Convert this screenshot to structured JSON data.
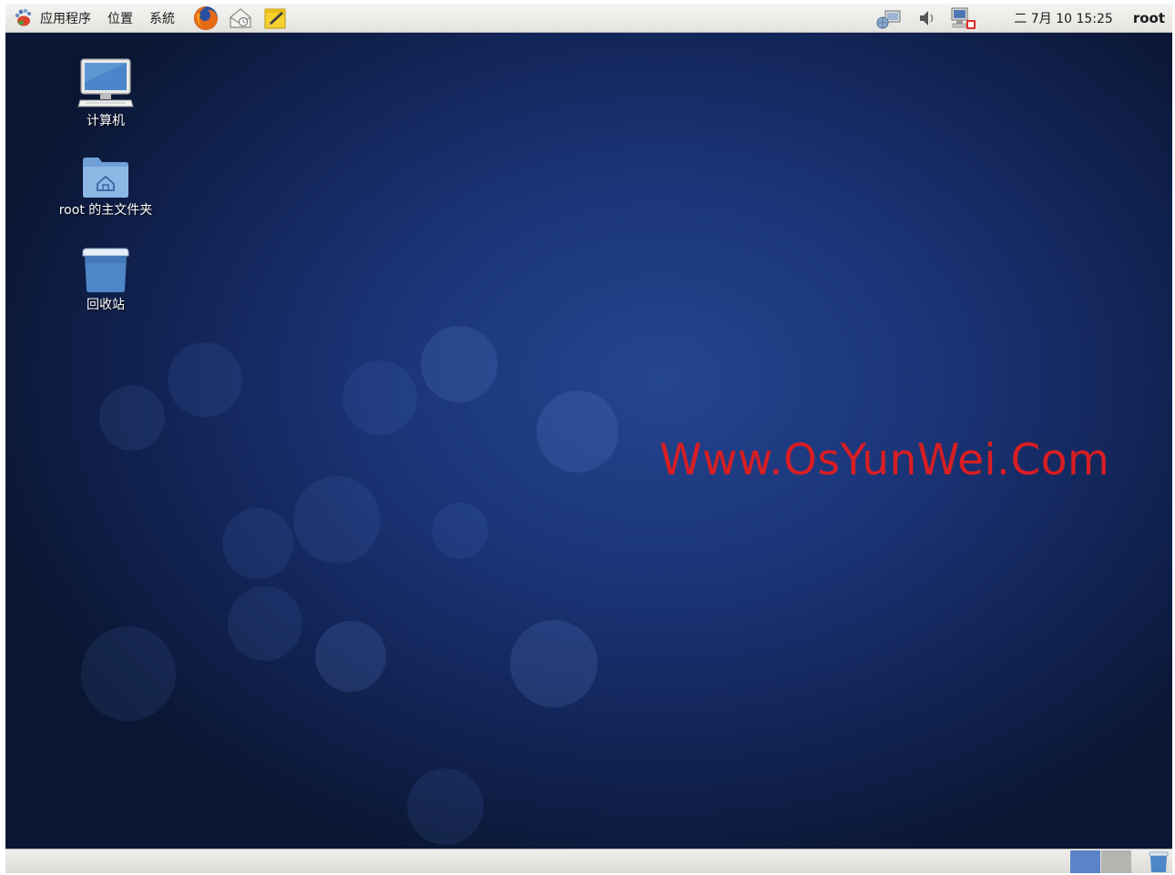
{
  "top_panel": {
    "menus": {
      "applications": "应用程序",
      "places": "位置",
      "system": "系統"
    },
    "launchers": [
      "firefox-icon",
      "mail-icon",
      "notes-icon"
    ],
    "tray_icons": [
      "network-connection-icon",
      "volume-icon",
      "software-update-icon"
    ],
    "clock": "二 7月 10 15:25",
    "user": "root"
  },
  "desktop": {
    "icons": {
      "computer": "计算机",
      "home": "root 的主文件夹",
      "trash": "回收站"
    },
    "watermark": "Www.OsYunWei.Com"
  },
  "bottom_panel": {
    "workspaces": [
      "workspace-1",
      "workspace-2"
    ],
    "active_workspace": 1
  },
  "colors": {
    "desktop_blue": "#1b3579",
    "watermark_red": "#d81e23",
    "panel_gray": "#e9e8e4"
  }
}
